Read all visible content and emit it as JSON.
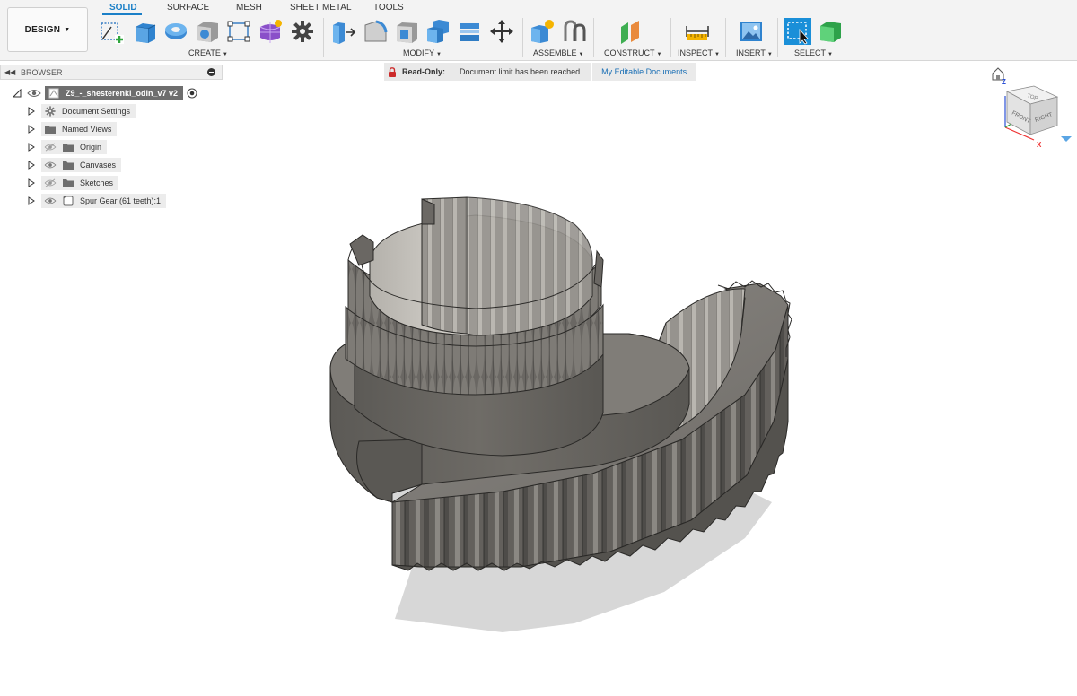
{
  "toolbar": {
    "workspace_button": "DESIGN",
    "tabs": [
      {
        "label": "SOLID",
        "active": true
      },
      {
        "label": "SURFACE",
        "active": false
      },
      {
        "label": "MESH",
        "active": false
      },
      {
        "label": "SHEET METAL",
        "active": false
      },
      {
        "label": "TOOLS",
        "active": false
      }
    ],
    "groups": {
      "create": "CREATE",
      "modify": "MODIFY",
      "assemble": "ASSEMBLE",
      "construct": "CONSTRUCT",
      "inspect": "INSPECT",
      "insert": "INSERT",
      "select": "SELECT"
    },
    "accent_color": "#1a7fc7"
  },
  "browser": {
    "title": "BROWSER",
    "root": "Z9_-_shesterenki_odin_v7 v2",
    "items": [
      {
        "label": "Document Settings",
        "icon": "gear-icon"
      },
      {
        "label": "Named Views",
        "icon": "folder-icon"
      },
      {
        "label": "Origin",
        "icon": "folder-icon",
        "visibility": "hidden"
      },
      {
        "label": "Canvases",
        "icon": "folder-icon",
        "visibility": "visible"
      },
      {
        "label": "Sketches",
        "icon": "folder-icon",
        "visibility": "hidden"
      },
      {
        "label": "Spur Gear (61 teeth):1",
        "icon": "component-icon",
        "visibility": "visible"
      }
    ]
  },
  "banner": {
    "label": "Read-Only:",
    "message": "Document limit has been reached",
    "link": "My Editable Documents",
    "lock_color": "#cc2a2a"
  },
  "viewcube": {
    "top": "TOP",
    "front": "FRONT",
    "right": "RIGHT",
    "axis_z": "Z",
    "axis_x": "X"
  }
}
